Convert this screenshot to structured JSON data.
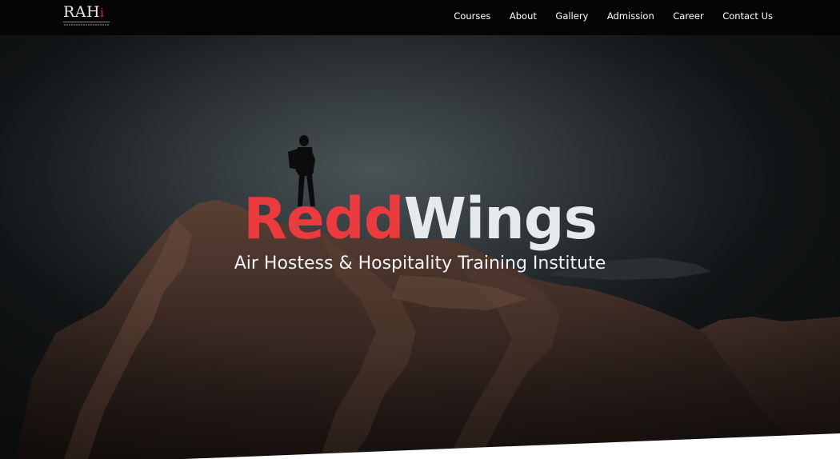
{
  "logo": {
    "text": "RAH",
    "accent": "i"
  },
  "nav": {
    "items": [
      "Courses",
      "About",
      "Gallery",
      "Admission",
      "Career",
      "Contact Us"
    ]
  },
  "hero": {
    "brand_part1": "Redd",
    "brand_part2": "Wings",
    "subtitle": "Air Hostess & Hospitality Training Institute"
  },
  "colors": {
    "brand_red": "#ec3b3f",
    "brand_white": "#e6eaeb",
    "header_bg": "#050505"
  }
}
